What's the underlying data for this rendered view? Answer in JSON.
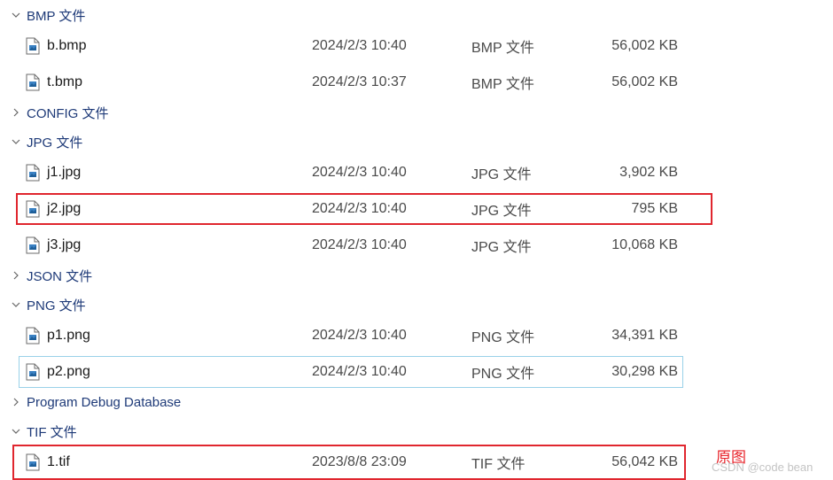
{
  "groups": [
    {
      "label": "BMP 文件",
      "expanded": true,
      "files": [
        {
          "name": "b.bmp",
          "date": "2024/2/3 10:40",
          "type": "BMP 文件",
          "size": "56,002 KB"
        },
        {
          "name": "t.bmp",
          "date": "2024/2/3 10:37",
          "type": "BMP 文件",
          "size": "56,002 KB"
        }
      ]
    },
    {
      "label": "CONFIG 文件",
      "expanded": false,
      "files": []
    },
    {
      "label": "JPG 文件",
      "expanded": true,
      "files": [
        {
          "name": "j1.jpg",
          "date": "2024/2/3 10:40",
          "type": "JPG 文件",
          "size": "3,902 KB"
        },
        {
          "name": "j2.jpg",
          "date": "2024/2/3 10:40",
          "type": "JPG 文件",
          "size": "795 KB"
        },
        {
          "name": "j3.jpg",
          "date": "2024/2/3 10:40",
          "type": "JPG 文件",
          "size": "10,068 KB"
        }
      ]
    },
    {
      "label": "JSON 文件",
      "expanded": false,
      "files": []
    },
    {
      "label": "PNG 文件",
      "expanded": true,
      "files": [
        {
          "name": "p1.png",
          "date": "2024/2/3 10:40",
          "type": "PNG 文件",
          "size": "34,391 KB"
        },
        {
          "name": "p2.png",
          "date": "2024/2/3 10:40",
          "type": "PNG 文件",
          "size": "30,298 KB"
        }
      ]
    },
    {
      "label": "Program Debug Database",
      "expanded": false,
      "files": []
    },
    {
      "label": "TIF 文件",
      "expanded": true,
      "files": [
        {
          "name": "1.tif",
          "date": "2023/8/8 23:09",
          "type": "TIF 文件",
          "size": "56,042 KB"
        }
      ]
    }
  ],
  "annotation": {
    "text": "原图"
  },
  "watermark": {
    "text": "CSDN @code bean"
  },
  "colors": {
    "group_text": "#1e3a78",
    "highlight_box": "#e0262e",
    "focus_outline": "#99d1e9",
    "annotation": "#e8232a"
  },
  "icons": {
    "file": "image-file-icon",
    "expanded": "chevron-down-icon",
    "collapsed": "chevron-right-icon"
  }
}
